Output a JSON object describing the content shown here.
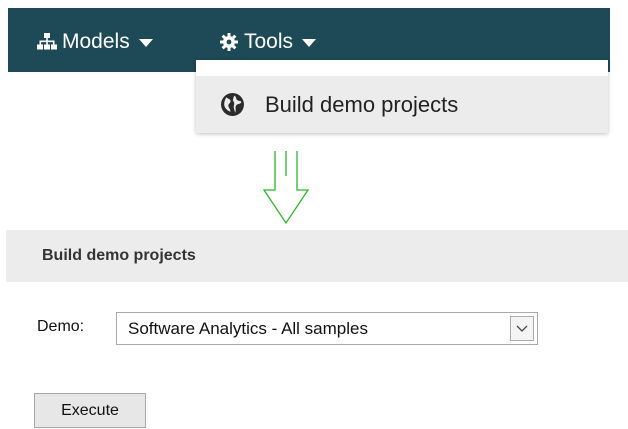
{
  "nav": {
    "models": {
      "label": "Models",
      "icon": "sitemap-icon"
    },
    "tools": {
      "label": "Tools",
      "icon": "gear-icon"
    }
  },
  "dropdown": {
    "items": [
      {
        "label": "Build demo projects",
        "icon": "globe-icon"
      }
    ]
  },
  "section": {
    "title": "Build demo projects"
  },
  "form": {
    "demo_label": "Demo:",
    "demo_value": "Software Analytics - All samples",
    "execute_label": "Execute"
  },
  "colors": {
    "navbar_bg": "#1d4a56",
    "menu_item_bg": "#ececec",
    "arrow": "#2db52d"
  }
}
